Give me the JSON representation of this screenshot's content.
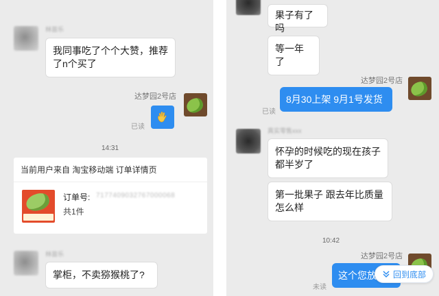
{
  "left": {
    "sender_blurred": "林苗乐",
    "msg1": "我同事吃了个个大赞，推荐了n个买了",
    "store_name": "达梦园2号店",
    "read_label": "已读",
    "wave_icon": "hand-wave-icon",
    "time1": "14:31",
    "order_card": {
      "header": "当前用户来自 淘宝移动端 订单详情页",
      "order_label": "订单号:",
      "order_number_blurred": "7177409032767000068",
      "count": "共1件"
    },
    "sender2_blurred": "林苗乐",
    "msg2": "掌柜，不卖猕猴桃了?"
  },
  "right": {
    "msg_top": "果子有了吗",
    "msg_wait": "等一年了",
    "store_name": "达梦园2号店",
    "seller_msg": "8月30上架  9月1号发货",
    "read_label": "已读",
    "sender_blurred": "真实零售xxx",
    "msg_pregnant": "怀孕的时候吃的现在孩子都半岁了",
    "msg_quality": "第一批果子  跟去年比质量怎么样",
    "time2": "10:42",
    "store_name2": "达梦园2号店",
    "seller_msg2": "这个您放心",
    "unread_label": "未读",
    "back_to_bottom": "回到底部",
    "colors": {
      "accent": "#2e8df0",
      "background": "#ebebeb"
    }
  }
}
